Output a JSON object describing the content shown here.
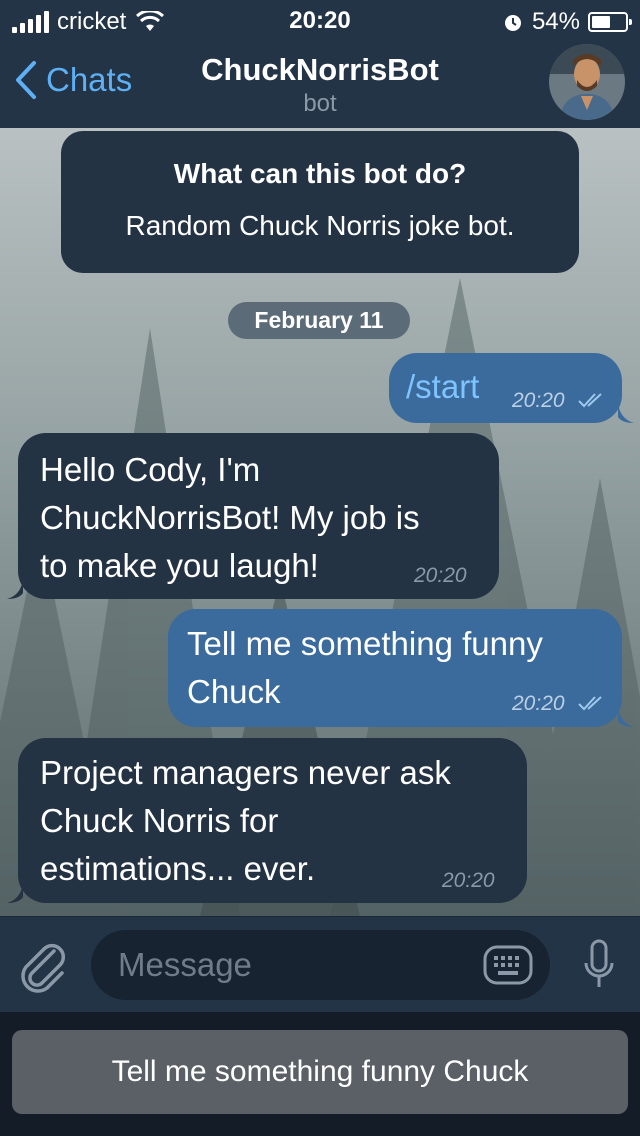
{
  "status": {
    "carrier": "cricket",
    "time": "20:20",
    "battery": "54%",
    "battery_level": 0.54
  },
  "header": {
    "back_label": "Chats",
    "title": "ChuckNorrisBot",
    "subtitle": "bot"
  },
  "info_card": {
    "heading": "What can this bot do?",
    "text": "Random Chuck Norris joke bot."
  },
  "date_separator": "February 11",
  "messages": [
    {
      "direction": "outgoing",
      "lines": [
        "/start"
      ],
      "time": "20:20",
      "read": true
    },
    {
      "direction": "incoming",
      "lines": [
        "Hello Cody, I'm",
        "ChuckNorrisBot! My job is",
        "to make you laugh!"
      ],
      "time": "20:20"
    },
    {
      "direction": "outgoing",
      "lines": [
        "Tell me something funny",
        "Chuck"
      ],
      "time": "20:20",
      "read": true
    },
    {
      "direction": "incoming",
      "lines": [
        "Project managers never ask",
        "Chuck Norris for",
        "estimations... ever."
      ],
      "time": "20:20"
    }
  ],
  "composer": {
    "placeholder": "Message"
  },
  "reply_keyboard": {
    "button_label": "Tell me something funny Chuck"
  },
  "colors": {
    "accent": "#5eb0f5",
    "incoming_bubble": "#243344",
    "outgoing_bubble": "#3a6b9c",
    "header_bg": "#243447"
  }
}
